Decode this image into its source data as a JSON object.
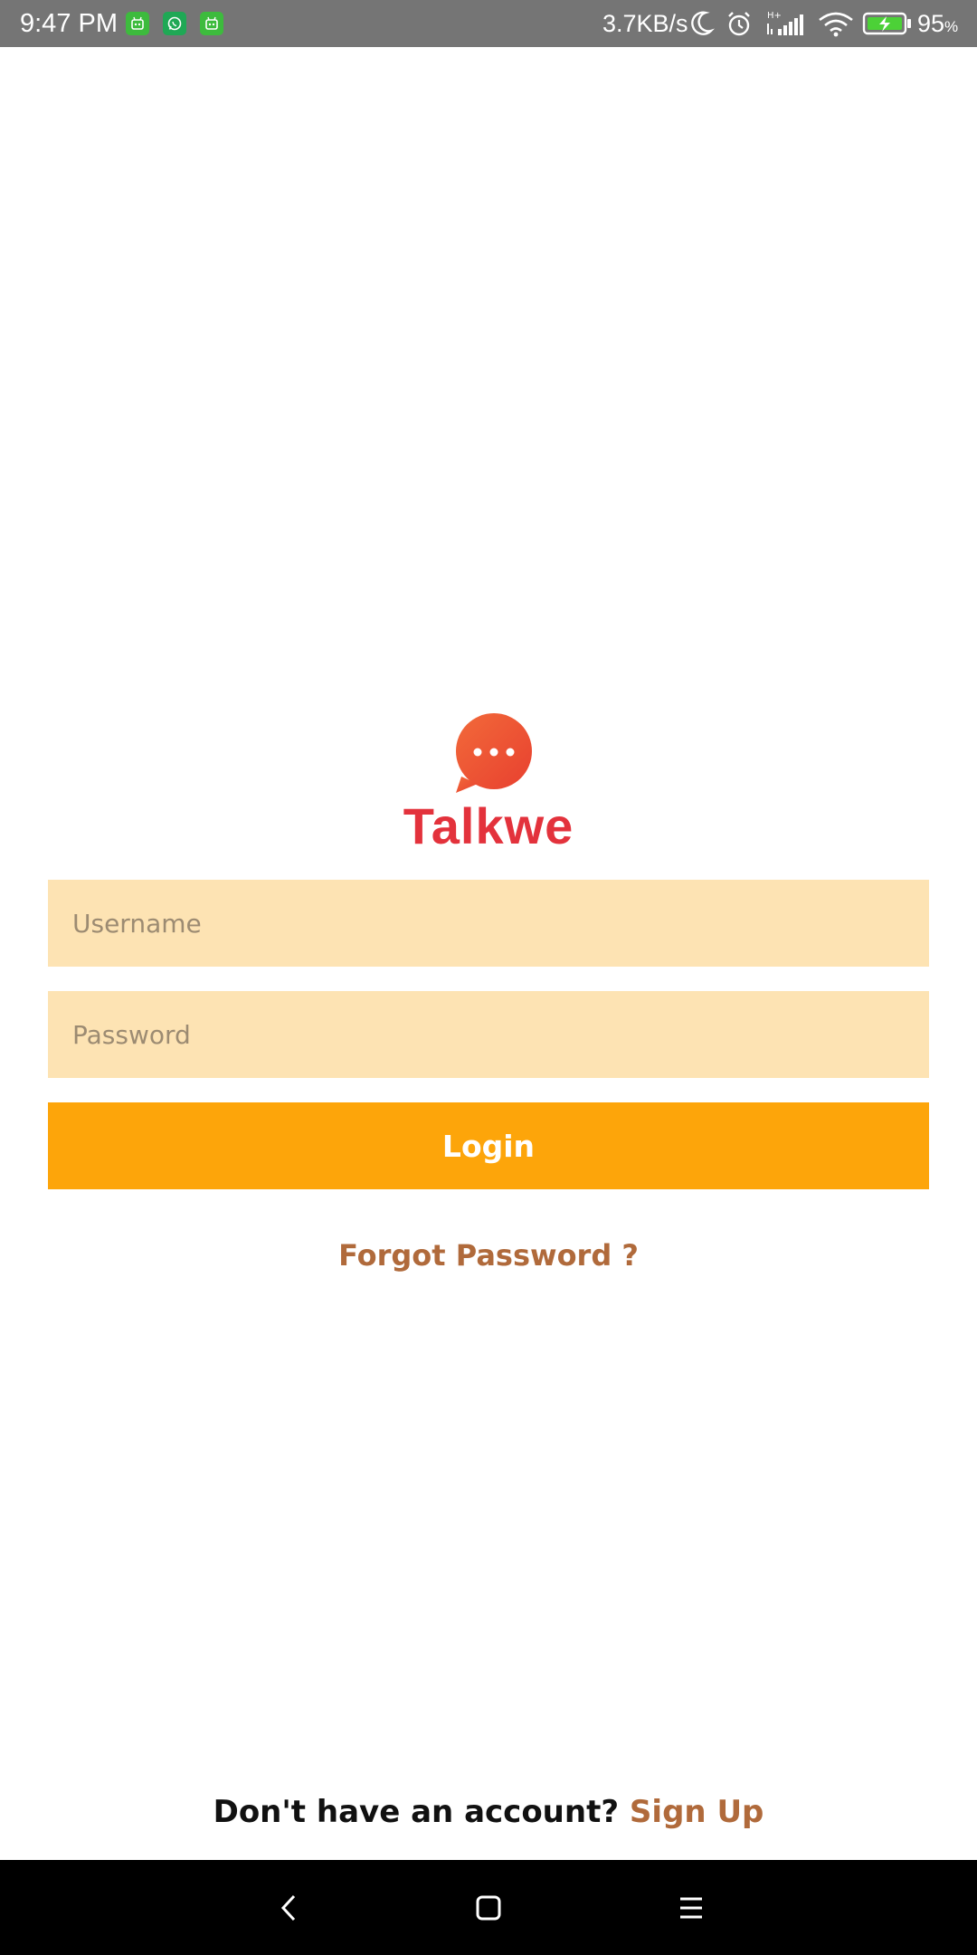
{
  "status_bar": {
    "time": "9:47 PM",
    "notifications": [
      {
        "icon": "robot-icon",
        "color": "#3dbb3d"
      },
      {
        "icon": "whatsapp-icon",
        "color": "#1fa855"
      },
      {
        "icon": "robot-icon",
        "color": "#3dbb3d"
      }
    ],
    "network_speed": "3.7KB/s",
    "icons": [
      "moon-icon",
      "alarm-icon",
      "signal-icon",
      "wifi-icon",
      "battery-icon"
    ],
    "network_type": "H+",
    "battery_percent": "95",
    "battery_unit": "%"
  },
  "logo": {
    "icon": "chat-bubble-icon",
    "brand_name": "Talkwe",
    "colors": {
      "bubble": "#f0503a",
      "text": "#e3323c"
    }
  },
  "login_form": {
    "username_placeholder": "Username",
    "password_placeholder": "Password",
    "login_label": "Login",
    "forgot_password_label": "Forgot Password ?"
  },
  "signup": {
    "prompt": "Don't have an account?",
    "link_label": "Sign Up"
  },
  "nav_bar": {
    "buttons": [
      "back-icon",
      "home-icon",
      "menu-icon"
    ]
  },
  "colors": {
    "field_background": "#fde3b3",
    "button_background": "#fda50a",
    "link": "#b06a3b",
    "status_bar": "#757575"
  }
}
